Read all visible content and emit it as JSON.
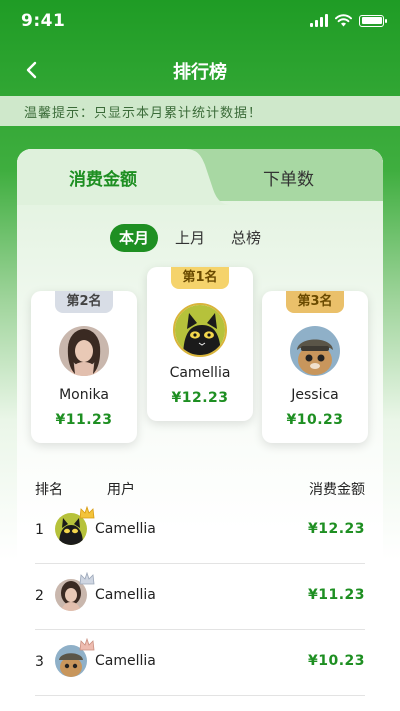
{
  "status_bar": {
    "time": "9:41"
  },
  "nav": {
    "title": "排行榜"
  },
  "notice": {
    "text": "温馨提示：只显示本月累计统计数据！"
  },
  "tabs": [
    {
      "label": "消费金额",
      "active": true
    },
    {
      "label": "下单数",
      "active": false
    }
  ],
  "periods": [
    {
      "label": "本月",
      "active": true
    },
    {
      "label": "上月",
      "active": false
    },
    {
      "label": "总榜",
      "active": false
    }
  ],
  "podium": {
    "first": {
      "rank_label": "第1名",
      "name": "Camellia",
      "amount": "¥12.23",
      "avatar": "black-cat"
    },
    "second": {
      "rank_label": "第2名",
      "name": "Monika",
      "amount": "¥11.23",
      "avatar": "woman-portrait"
    },
    "third": {
      "rank_label": "第3名",
      "name": "Jessica",
      "amount": "¥10.23",
      "avatar": "cat-with-helmet"
    }
  },
  "table": {
    "headers": {
      "rank": "排名",
      "user": "用户",
      "amount": "消费金额"
    },
    "rows": [
      {
        "rank": "1",
        "name": "Camellia",
        "amount": "¥12.23",
        "crown": "gold"
      },
      {
        "rank": "2",
        "name": "Camellia",
        "amount": "¥11.23",
        "crown": "silver"
      },
      {
        "rank": "3",
        "name": "Camellia",
        "amount": "¥10.23",
        "crown": "bronze"
      }
    ]
  },
  "colors": {
    "brand_green": "#1e8f22",
    "gold": "#f5d36c",
    "silver": "#d8dde6",
    "bronze": "#e8b6a8"
  }
}
